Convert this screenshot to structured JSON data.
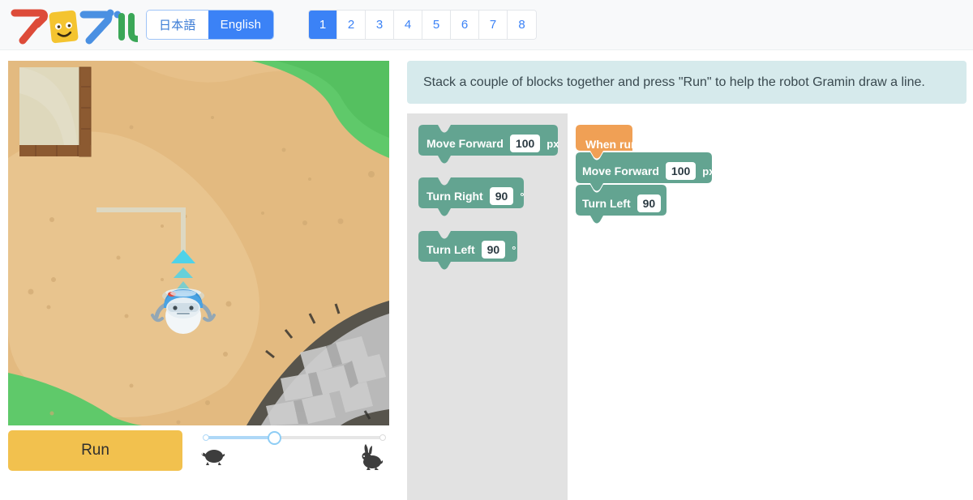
{
  "header": {
    "logo_alt": "Programmable logo",
    "logo_text": "プログル",
    "languages": [
      {
        "label": "日本語",
        "active": false
      },
      {
        "label": "English",
        "active": true
      }
    ],
    "pages": [
      {
        "label": "1",
        "active": true
      },
      {
        "label": "2",
        "active": false
      },
      {
        "label": "3",
        "active": false
      },
      {
        "label": "4",
        "active": false
      },
      {
        "label": "5",
        "active": false
      },
      {
        "label": "6",
        "active": false
      },
      {
        "label": "7",
        "active": false
      },
      {
        "label": "8",
        "active": false
      }
    ]
  },
  "instruction": {
    "text": "Stack a couple of blocks together and press \"Run\" to help the robot Gramin draw a line."
  },
  "controls": {
    "run_label": "Run",
    "slow_icon": "turtle-icon",
    "fast_icon": "rabbit-icon",
    "speed_percent": 38
  },
  "palette": {
    "blocks": [
      {
        "label": "Move Forward",
        "value": "100",
        "unit": "px",
        "type": "move-forward"
      },
      {
        "label": "Turn Right",
        "value": "90",
        "unit": "°",
        "type": "turn-right"
      },
      {
        "label": "Turn Left",
        "value": "90",
        "unit": "°",
        "type": "turn-left"
      }
    ]
  },
  "workspace": {
    "blocks": [
      {
        "label": "When run",
        "value": "",
        "unit": "",
        "type": "when-run"
      },
      {
        "label": "Move Forward",
        "value": "100",
        "unit": "px",
        "type": "move-forward"
      },
      {
        "label": "Turn Left",
        "value": "90",
        "unit": "°",
        "type": "turn-left"
      }
    ]
  },
  "stage": {
    "robot_name": "Gramin",
    "path_drawn": true
  },
  "colors": {
    "accent_blue": "#3b82f6",
    "block_green": "#63a491",
    "block_orange": "#f0a055",
    "run_yellow": "#f2c14e",
    "banner_teal": "#d6eaec",
    "palette_gray": "#e2e2e2",
    "sand": "#e2b97f",
    "grass": "#5fc96a"
  }
}
